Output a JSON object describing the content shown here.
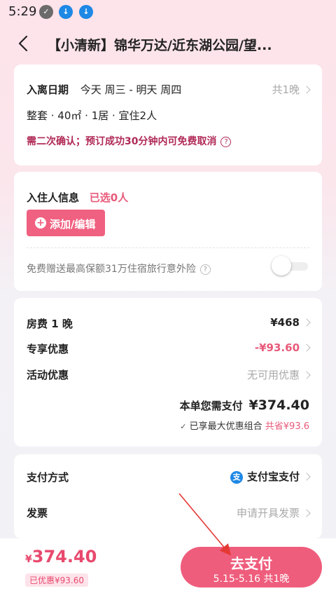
{
  "status_bar": {
    "time": "5:29",
    "icons": [
      "notification-icon",
      "download-icon",
      "download-icon"
    ]
  },
  "header": {
    "title": "【小清新】锦华万达/近东湖公园/望..."
  },
  "stay": {
    "label": "入离日期",
    "dates": "今天 周三 - 明天 周四",
    "nights": "共1晚",
    "details": "整套 · 40㎡ · 1居 · 宜住2人",
    "notice": "需二次确认；预订成功30分钟内可免费取消"
  },
  "guests": {
    "label": "入住人信息",
    "selected": "已选0人",
    "add_button": "添加/编辑",
    "insurance_text": "免费赠送最高保额31万住宿旅行意外险"
  },
  "pricing": {
    "room_label": "房费 1 晚",
    "room_value": "¥468",
    "exclusive_label": "专享优惠",
    "exclusive_value": "-¥93.60",
    "activity_label": "活动优惠",
    "activity_value": "无可用优惠",
    "total_label": "本单您需支付",
    "total_value": "¥374.40",
    "combo_text": "已享最大优惠组合",
    "saved_text": "共省¥93.6"
  },
  "payment": {
    "method_label": "支付方式",
    "method_value": "支付宝支付",
    "method_icon_glyph": "支",
    "invoice_label": "发票",
    "invoice_value": "申请开具发票"
  },
  "bottom": {
    "currency": "¥",
    "amount": "374.40",
    "discount_badge": "已优惠¥93.60",
    "pay_button": "去支付",
    "pay_sub": "5.15-5.16 共1晚"
  },
  "colors": {
    "accent": "#ef5d7c",
    "warning_text": "#b02a55",
    "alipay": "#1e88e5",
    "annotation_arrow": "#e53935"
  }
}
